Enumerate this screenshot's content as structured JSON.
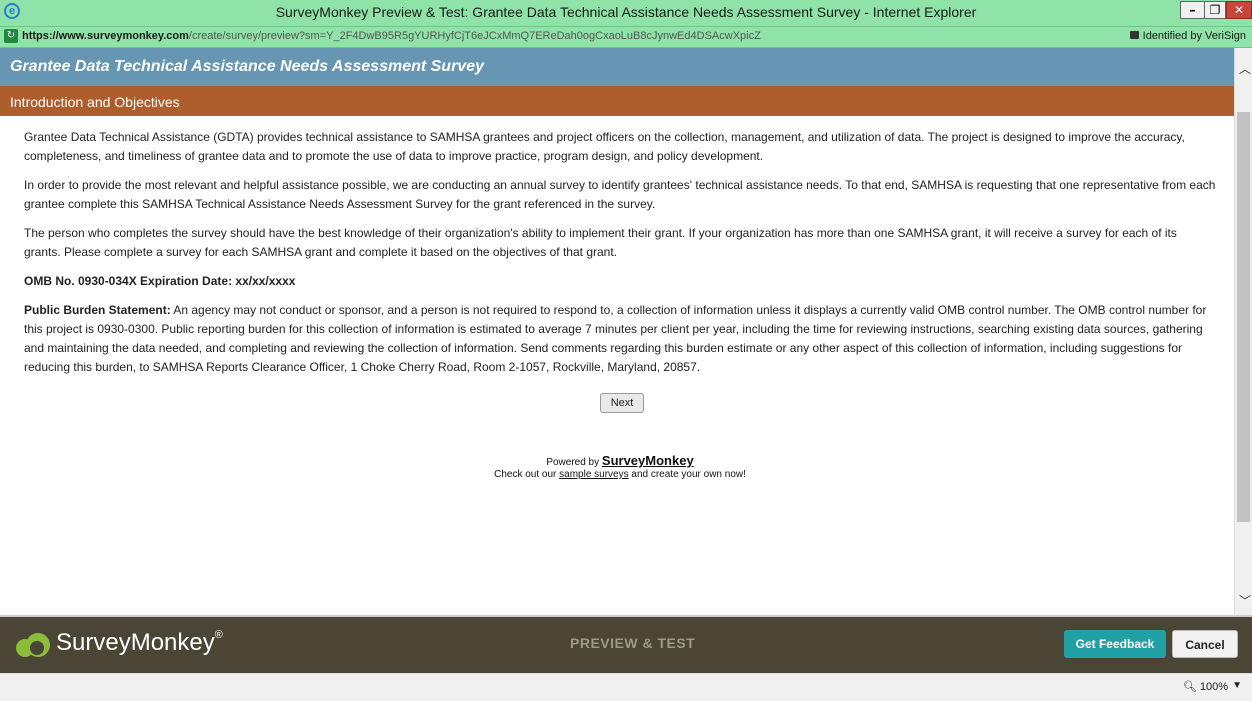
{
  "window": {
    "title": "SurveyMonkey Preview & Test: Grantee Data Technical Assistance Needs Assessment Survey - Internet Explorer",
    "min_glyph": "–",
    "max_glyph": "❐",
    "close_glyph": "✕"
  },
  "address": {
    "scheme": "https://www.",
    "domain": "surveymonkey.com",
    "path": "/create/survey/preview?sm=Y_2F4DwB95R5gYURHyfCjT6eJCxMmQ7EReDah0ogCxaoLuB8cJynwEd4DSAcwXpicZ",
    "identity": "Identified by VeriSign"
  },
  "survey": {
    "title": "Grantee Data Technical Assistance Needs Assessment Survey",
    "section": "Introduction and Objectives",
    "paragraphs": [
      "Grantee Data Technical Assistance (GDTA) provides technical assistance to SAMHSA grantees and project officers on the collection, management, and utilization of data. The project is designed to improve the accuracy, completeness, and timeliness of grantee data and to promote the use of data to improve practice, program design, and policy development.",
      "In order to provide the most relevant and helpful assistance possible, we are conducting an annual survey to identify grantees' technical assistance needs. To that end, SAMHSA is requesting that one representative from each grantee complete this SAMHSA Technical Assistance Needs Assessment Survey for the grant referenced in the survey.",
      "The person who completes the survey should have the best knowledge of their organization's ability to implement their grant. If your organization has more than one SAMHSA grant, it will receive a survey for each of its grants. Please complete a survey for each SAMHSA grant and complete it based on the objectives of that grant."
    ],
    "omb": "OMB No. 0930-034X Expiration Date: xx/xx/xxxx",
    "burden_label": "Public Burden Statement:",
    "burden_text": " An agency may not conduct or sponsor, and a person is not required to respond to, a collection of information unless it displays a currently valid OMB control number. The OMB control number for this project is 0930-0300. Public reporting burden for this collection of information is estimated to average 7 minutes per client per year, including the time for reviewing instructions, searching existing data sources, gathering and maintaining the data needed, and completing and reviewing the collection of information. Send comments regarding this burden estimate or any other aspect of this collection of information, including suggestions for reducing this burden, to SAMHSA Reports Clearance Officer, 1 Choke Cherry Road, Room 2-1057, Rockville, Maryland, 20857.",
    "next_label": "Next"
  },
  "powered": {
    "prefix": "Powered by ",
    "brand": "SurveyMonkey",
    "line2_pre": "Check out our ",
    "link": "sample surveys",
    "line2_post": " and create your own now!"
  },
  "footer": {
    "logo_text": "SurveyMonkey",
    "logo_reg": "®",
    "mode": "PREVIEW & TEST",
    "feedback_label": "Get Feedback",
    "cancel_label": "Cancel"
  },
  "status": {
    "zoom": "100%"
  }
}
